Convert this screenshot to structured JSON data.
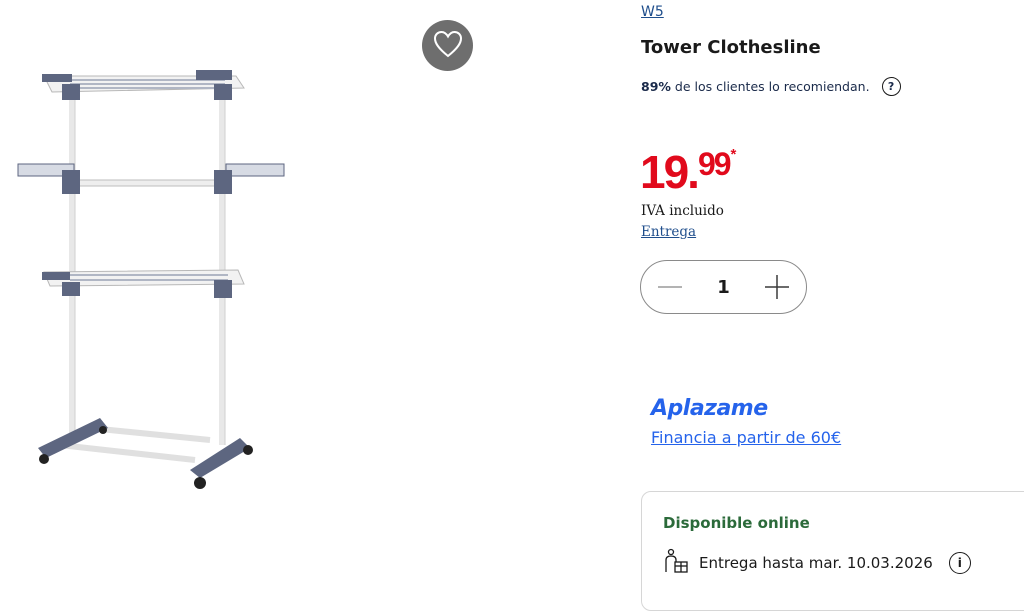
{
  "product": {
    "brand": "W5",
    "title": "Tower Clothesline",
    "recommendation": {
      "percent": "89%",
      "text": "de los clientes lo recomiendan."
    },
    "price": {
      "integer": "19",
      "separator": ".",
      "decimals": "99",
      "asterisk": "*"
    },
    "vat_text": "IVA incluido",
    "delivery_link": "Entrega",
    "quantity": "1"
  },
  "financing": {
    "provider": "Aplazame",
    "link": "Financia a partir de 60€"
  },
  "availability": {
    "title": "Disponible online",
    "shipping": "Entrega hasta mar. 10.03.2026"
  },
  "icons": {
    "favorite": "heart-icon",
    "help": "question-icon",
    "minus": "minus-icon",
    "plus": "plus-icon",
    "shipping": "package-icon",
    "info": "info-icon"
  },
  "colors": {
    "price": "#e10a1c",
    "link": "#1f4e8c",
    "aplazame": "#2563eb",
    "available": "#2b6a3a"
  }
}
